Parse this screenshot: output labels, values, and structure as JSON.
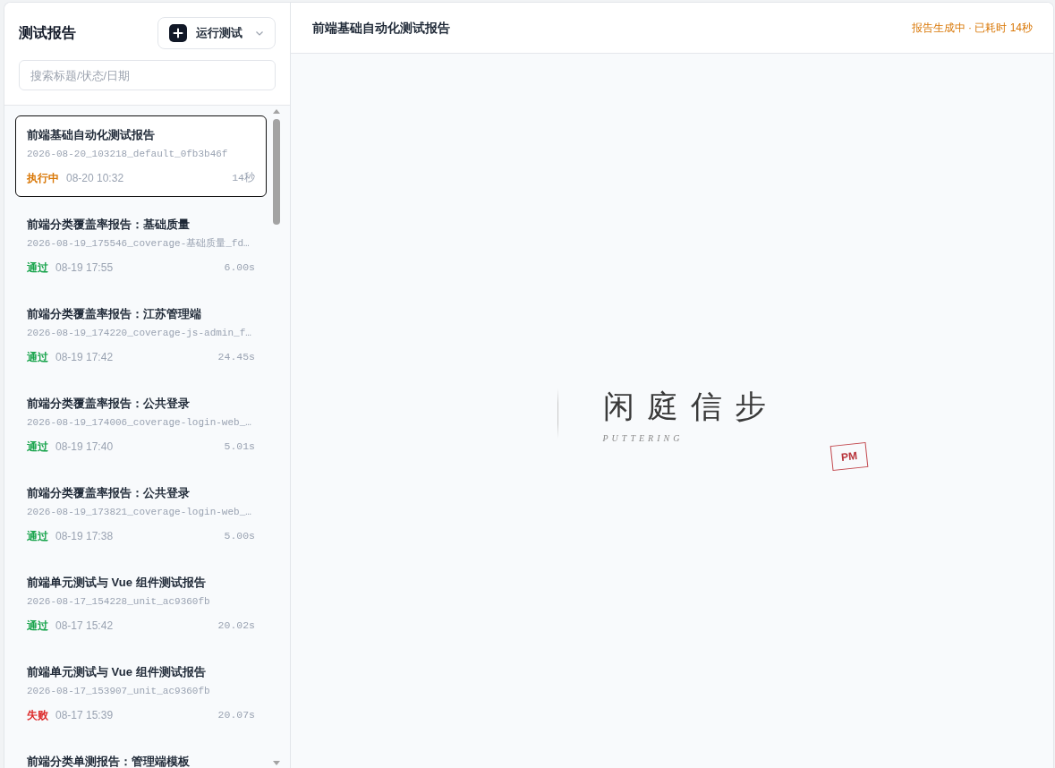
{
  "sidebar": {
    "title": "测试报告",
    "run_button": {
      "label": "运行测试"
    },
    "search": {
      "placeholder": "搜索标题/状态/日期"
    },
    "reports": [
      {
        "title": "前端基础自动化测试报告",
        "subtitle": "2026-08-20_103218_default_0fb3b46f",
        "status": {
          "kind": "running",
          "label": "执行中"
        },
        "time": "08-20 10:32",
        "duration": "14秒",
        "selected": true
      },
      {
        "title": "前端分类覆盖率报告：基础质量",
        "subtitle": "2026-08-19_175546_coverage-基础质量_fd…",
        "status": {
          "kind": "passed",
          "label": "通过"
        },
        "time": "08-19 17:55",
        "duration": "6.00s",
        "selected": false
      },
      {
        "title": "前端分类覆盖率报告：江苏管理端",
        "subtitle": "2026-08-19_174220_coverage-js-admin_f…",
        "status": {
          "kind": "passed",
          "label": "通过"
        },
        "time": "08-19 17:42",
        "duration": "24.45s",
        "selected": false
      },
      {
        "title": "前端分类覆盖率报告：公共登录",
        "subtitle": "2026-08-19_174006_coverage-login-web_…",
        "status": {
          "kind": "passed",
          "label": "通过"
        },
        "time": "08-19 17:40",
        "duration": "5.01s",
        "selected": false
      },
      {
        "title": "前端分类覆盖率报告：公共登录",
        "subtitle": "2026-08-19_173821_coverage-login-web_…",
        "status": {
          "kind": "passed",
          "label": "通过"
        },
        "time": "08-19 17:38",
        "duration": "5.00s",
        "selected": false
      },
      {
        "title": "前端单元测试与 Vue 组件测试报告",
        "subtitle": "2026-08-17_154228_unit_ac9360fb",
        "status": {
          "kind": "passed",
          "label": "通过"
        },
        "time": "08-17 15:42",
        "duration": "20.02s",
        "selected": false
      },
      {
        "title": "前端单元测试与 Vue 组件测试报告",
        "subtitle": "2026-08-17_153907_unit_ac9360fb",
        "status": {
          "kind": "failed",
          "label": "失败"
        },
        "time": "08-17 15:39",
        "duration": "20.07s",
        "selected": false
      },
      {
        "title": "前端分类单测报告：管理端模板",
        "selected": false
      }
    ]
  },
  "main": {
    "title": "前端基础自动化测试报告",
    "progress": "报告生成中 · 已耗时 14秒",
    "splash": {
      "title": "闲庭信步",
      "subtitle": "PUTTERING",
      "stamp": "PM"
    }
  }
}
